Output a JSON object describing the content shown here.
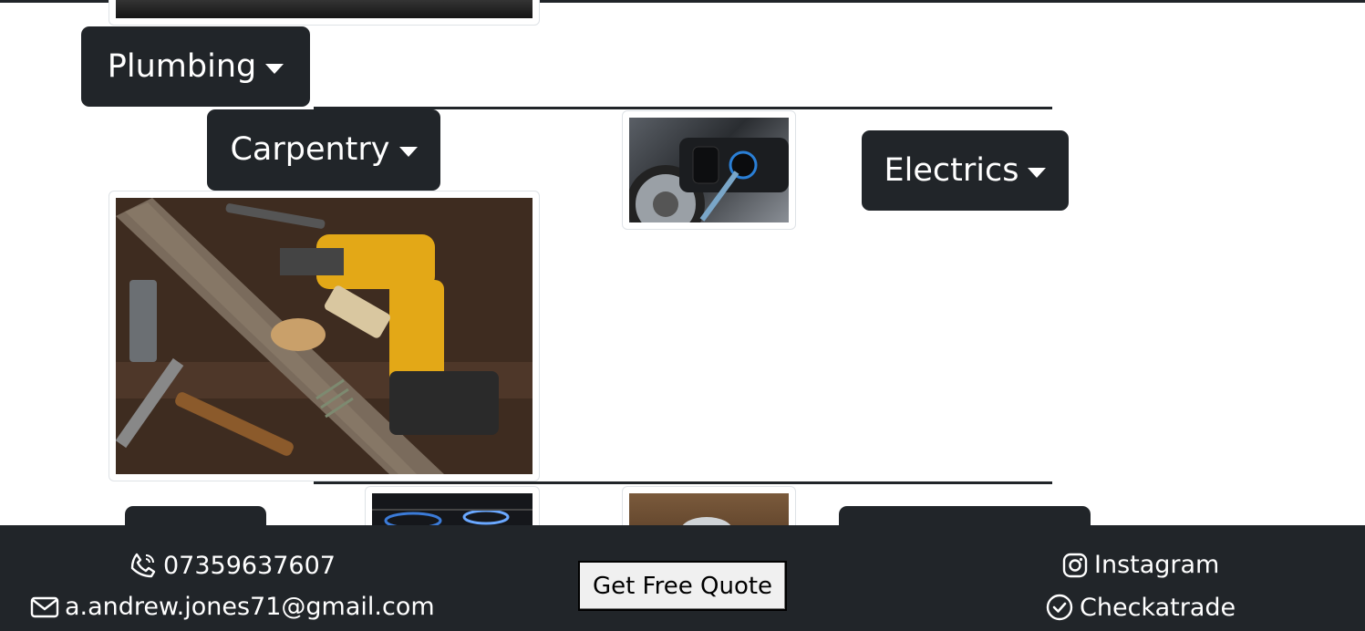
{
  "dropdowns": {
    "plumbing": "Plumbing",
    "carpentry": "Carpentry",
    "electrics": "Electrics"
  },
  "footer": {
    "phone": "07359637607",
    "email": "a.andrew.jones71@gmail.com",
    "quote_button": "Get Free Quote",
    "instagram": "Instagram",
    "checkatrade": "Checkatrade"
  },
  "icons": {
    "phone": "phone-icon",
    "email": "envelope-icon",
    "instagram": "instagram-icon",
    "checkatrade": "check-circle-icon",
    "caret": "caret-down-icon"
  },
  "colors": {
    "dark": "#212529",
    "button_bg": "#f0f0f0"
  }
}
